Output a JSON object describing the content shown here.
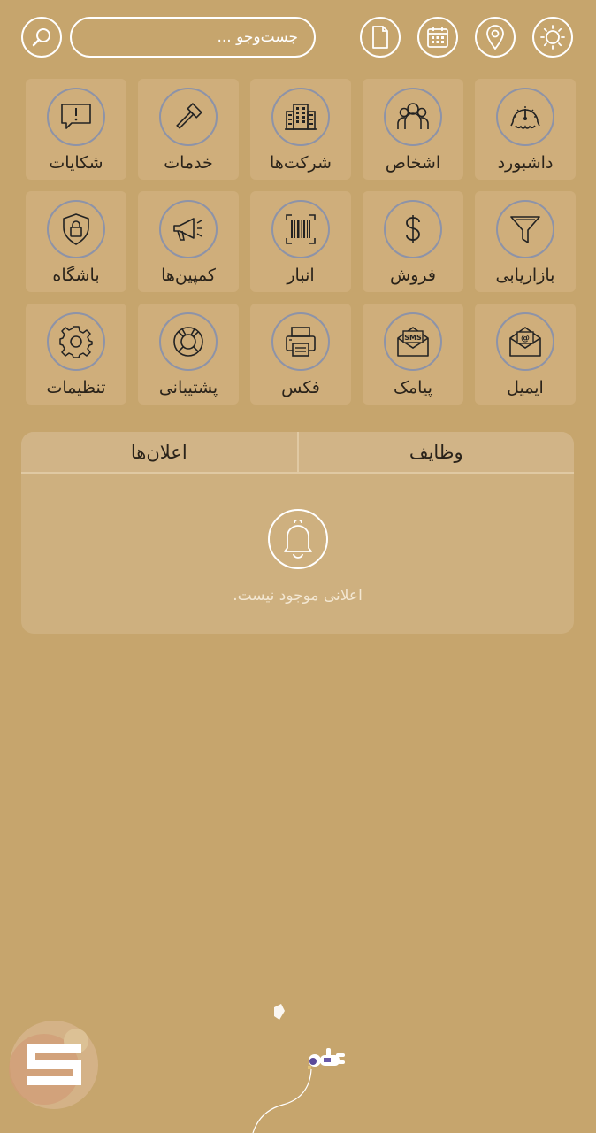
{
  "header": {
    "search_placeholder": "جست‌وجو ...",
    "icons": [
      "search-icon",
      "document-icon",
      "calendar-icon",
      "location-pin-icon",
      "sun-icon"
    ]
  },
  "tiles": [
    {
      "label": "داشبورد",
      "icon": "speedometer-icon"
    },
    {
      "label": "اشخاص",
      "icon": "people-icon"
    },
    {
      "label": "شرکت‌ها",
      "icon": "building-icon"
    },
    {
      "label": "خدمات",
      "icon": "hammer-icon"
    },
    {
      "label": "شکایات",
      "icon": "complaint-bubble-icon"
    },
    {
      "label": "بازاریابی",
      "icon": "funnel-icon"
    },
    {
      "label": "فروش",
      "icon": "dollar-icon"
    },
    {
      "label": "انبار",
      "icon": "barcode-icon"
    },
    {
      "label": "کمپین‌ها",
      "icon": "megaphone-icon"
    },
    {
      "label": "باشگاه",
      "icon": "shield-lock-icon"
    },
    {
      "label": "ایمیل",
      "icon": "email-icon"
    },
    {
      "label": "پیامک",
      "icon": "sms-icon"
    },
    {
      "label": "فکس",
      "icon": "fax-icon"
    },
    {
      "label": "پشتیبانی",
      "icon": "lifebuoy-icon"
    },
    {
      "label": "تنظیمات",
      "icon": "gear-icon"
    }
  ],
  "panel": {
    "tabs": [
      {
        "label": "وظایف"
      },
      {
        "label": "اعلان‌ها"
      }
    ],
    "empty_text": "اعلانی موجود نیست."
  },
  "colors": {
    "background": "#c6a56d",
    "tile": "#cfae7b",
    "icon_ring": "#8d93a8"
  }
}
